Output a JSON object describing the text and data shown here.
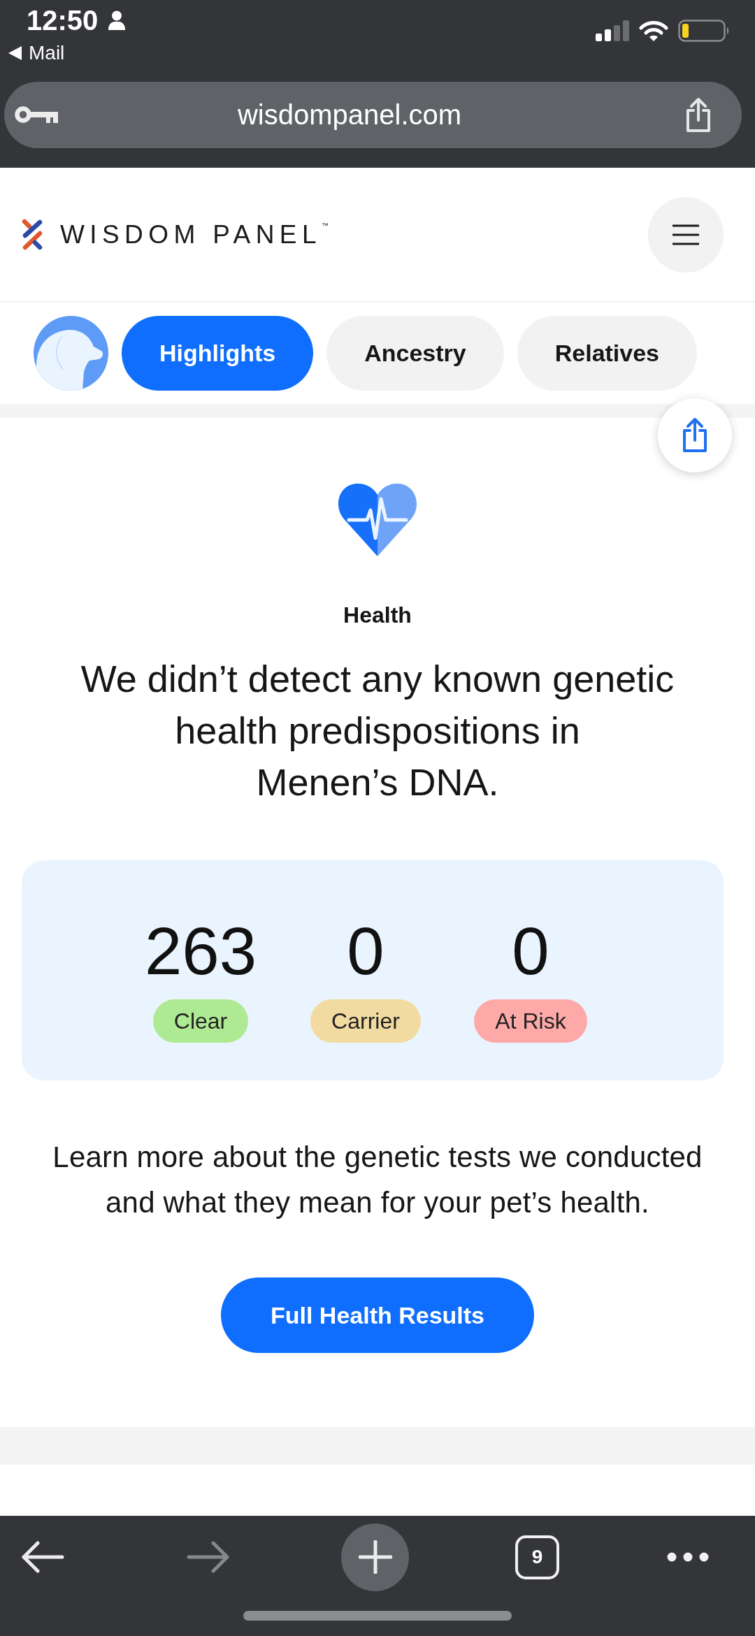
{
  "status_bar": {
    "time": "12:50",
    "back_link": "Mail"
  },
  "address_bar": {
    "url": "wisdompanel.com"
  },
  "header": {
    "logo": "WISDOM PANEL$^{™}$"
  },
  "tabs": [
    {
      "label": "Highlights",
      "selected": true
    },
    {
      "label": "Ancestry",
      "selected": false
    },
    {
      "label": "Relatives",
      "selected": false
    }
  ],
  "health": {
    "title": "Health",
    "summary": "We didn’t detect any known genetic health predispositions in Menen’s DNA.",
    "results": [
      {
        "count": "263",
        "label": "Clear",
        "color": "#aeea94"
      },
      {
        "count": "0",
        "label": "Carrier",
        "color": "#f2dba1"
      },
      {
        "count": "0",
        "label": "At Risk",
        "color": "#fca9a8"
      }
    ],
    "note": "Learn more about the genetic tests we conducted and what they mean for your pet’s health.",
    "button": "Full Health Results"
  },
  "browser_toolbar": {
    "tab_count": "9"
  }
}
